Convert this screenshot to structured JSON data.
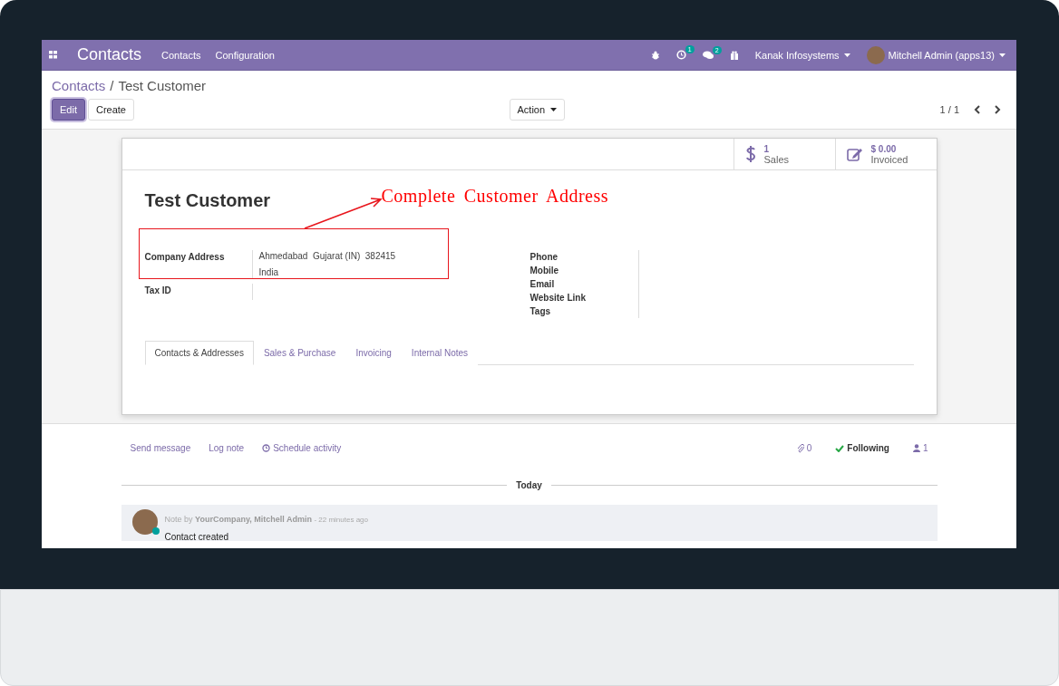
{
  "navbar": {
    "app_title": "Contacts",
    "menu": [
      "Contacts",
      "Configuration"
    ],
    "activity_count": "1",
    "message_count": "2",
    "company": "Kanak Infosystems",
    "user": "Mitchell Admin (apps13)"
  },
  "breadcrumb": {
    "parent": "Contacts",
    "separator": "/",
    "current": "Test Customer"
  },
  "buttons": [
    {
      "label": "Edit",
      "kind": "primary"
    },
    {
      "label": "Create",
      "kind": "secondary"
    }
  ],
  "action": "Action",
  "pager": "1 / 1",
  "smart_buttons": [
    {
      "kind": "sales",
      "value": "1",
      "label": "Sales"
    },
    {
      "kind": "invoiced",
      "value": "$ 0.00",
      "label": "Invoiced"
    }
  ],
  "record": {
    "name": "Test Customer",
    "left_fields": [
      {
        "label": "Company Address",
        "lines": [
          "Ahmedabad  Gujarat (IN)  382415",
          "India"
        ]
      },
      {
        "label": "Tax ID"
      }
    ],
    "right_fields": [
      "Phone",
      "Mobile",
      "Email",
      "Website Link",
      "Tags"
    ]
  },
  "annotation": "Complete Customer Address",
  "tabs": [
    {
      "label": "Contacts & Addresses",
      "selected": true
    },
    {
      "label": "Sales & Purchase",
      "selected": false
    },
    {
      "label": "Invoicing",
      "selected": false
    },
    {
      "label": "Internal Notes",
      "selected": false
    }
  ],
  "chatter": {
    "actions": [
      {
        "label": "Send message",
        "kind": "text"
      },
      {
        "label": "Log note",
        "kind": "text"
      },
      {
        "label": "Schedule activity",
        "kind": "clock"
      }
    ],
    "attachments": "0",
    "following": "Following",
    "followers": "1",
    "date_separator": "Today",
    "messages": [
      {
        "prefix": "Note by",
        "author": "YourCompany, Mitchell Admin",
        "time": "- 22 minutes ago",
        "body": "Contact created",
        "online": true
      }
    ]
  }
}
